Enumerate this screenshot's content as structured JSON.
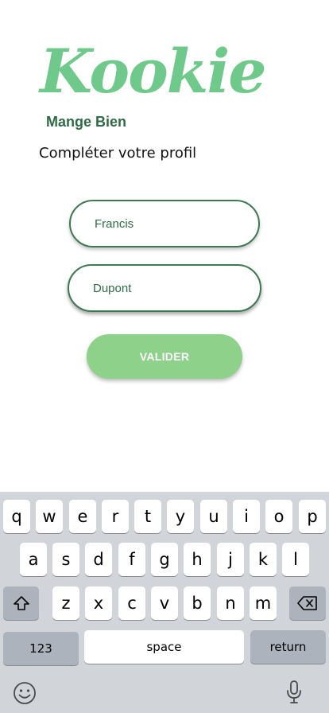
{
  "brand": {
    "logo": "Kookie",
    "tagline": "Mange Bien"
  },
  "form": {
    "title": "Compléter votre profil",
    "first_name_value": "Francis",
    "last_name_value": "Dupont",
    "submit_label": "VALIDER"
  },
  "keyboard": {
    "row1": [
      "q",
      "w",
      "e",
      "r",
      "t",
      "y",
      "u",
      "i",
      "o",
      "p"
    ],
    "row2": [
      "a",
      "s",
      "d",
      "f",
      "g",
      "h",
      "j",
      "k",
      "l"
    ],
    "row3": [
      "z",
      "x",
      "c",
      "v",
      "b",
      "n",
      "m"
    ],
    "numbers_label": "123",
    "space_label": "space",
    "return_label": "return",
    "shift_icon": "shift-icon",
    "backspace_icon": "backspace-icon",
    "emoji_icon": "emoji-icon",
    "mic_icon": "microphone-icon"
  },
  "colors": {
    "brand_green": "#6fc98a",
    "dark_green": "#2f6b45",
    "button_green": "#8ed18b",
    "keyboard_bg": "#d1d4d9"
  }
}
